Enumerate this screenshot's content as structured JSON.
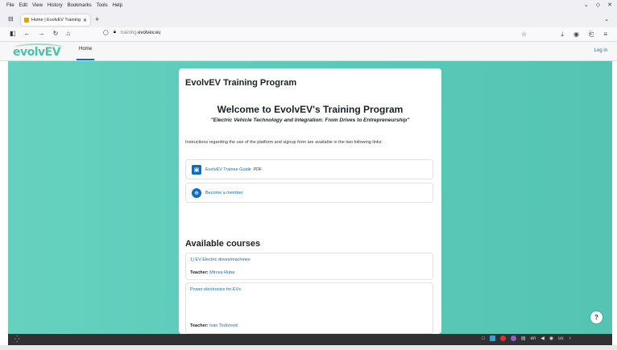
{
  "browser": {
    "menu": [
      "File",
      "Edit",
      "View",
      "History",
      "Bookmarks",
      "Tools",
      "Help"
    ],
    "tab_title": "Home | EvolvEV Training P",
    "url_prefix": "training.",
    "url_domain": "evolvev.eu"
  },
  "site": {
    "logo_text": "evolvEV",
    "nav_home": "Home",
    "login": "Log in"
  },
  "card": {
    "title": "EvolvEV Training Program",
    "welcome": "Welcome to EvolvEV's Training Program",
    "subtitle": "\"Electric Vehicle Technology and Integration: From Drives to Entrepreneurship\"",
    "instructions": "Instructions regarding the use of the platform and signup form are available in the two following links:",
    "links": [
      {
        "label": "EvolvEV Trainee Guide",
        "suffix": "PDF",
        "icon": "file-icon"
      },
      {
        "label": "Become a member",
        "suffix": "",
        "icon": "globe-icon"
      }
    ],
    "available_heading": "Available courses",
    "courses": [
      {
        "name": "1) EV Electric drives/machines",
        "teacher_label": "Teacher:",
        "teacher": "Mircea Ruba"
      },
      {
        "name": "Power electronics for EVs",
        "teacher_label": "Teacher:",
        "teacher": "Ivan Todorović"
      }
    ]
  },
  "help_label": "?",
  "taskbar": {
    "lang": "en",
    "layout": "us"
  }
}
